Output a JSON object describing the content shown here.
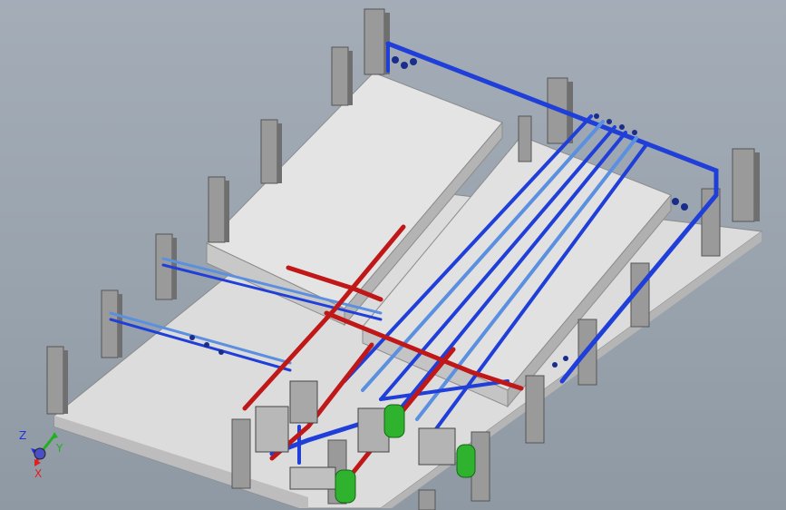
{
  "viewport": {
    "model": "piping-layout",
    "colors": {
      "background": "#9ea8b2",
      "floor": "#dcdcdc",
      "floor_side": "#b9b9b9",
      "tank_top": "#e2e2e2",
      "tank_side": "#c6c6c6",
      "column_face": "#9a9a9a",
      "column_side": "#6f6f6f",
      "pipe_blue": "#1f3fd8",
      "pipe_light_blue": "#5b8fe0",
      "pipe_red": "#c01818",
      "vessel_green": "#2fb32f"
    }
  },
  "triad": {
    "x_label": "X",
    "y_label": "Y",
    "z_label": "Z",
    "x_color": "#e02020",
    "y_color": "#20b020",
    "z_color": "#2030e0"
  }
}
